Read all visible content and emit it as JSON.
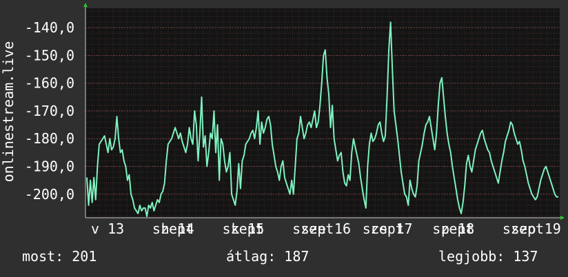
{
  "chart_data": {
    "type": "line",
    "ylabel": "onlinestream.live",
    "ylim": [
      -208.5,
      -133
    ],
    "y_ticks": [
      -200.0,
      -190.0,
      -180.0,
      -170.0,
      -160.0,
      -150.0,
      -140.0
    ],
    "y_tick_labels": [
      "-200,0",
      "-190,0",
      "-180,0",
      "-170,0",
      "-160,0",
      "-150,0",
      "-140,0"
    ],
    "x_tick_labels": [
      "v 13",
      "szept",
      "h 14",
      "szept",
      "k 15",
      "szept",
      "sze 16",
      "szept",
      "cs 17",
      "szept",
      "p 18",
      "szept",
      "szo 19",
      "szept"
    ],
    "x_tick_positions": [
      0.0,
      0.14,
      0.16,
      0.3,
      0.32,
      0.46,
      0.48,
      0.62,
      0.64,
      0.78,
      0.8,
      0.94,
      0.96,
      1.1
    ],
    "grid": true,
    "line_color": "#7ef2bf",
    "background_color": "#141414",
    "grid_color": "#5a3a3a",
    "series": [
      {
        "values": [
          -194,
          -204,
          -195,
          -203,
          -194,
          -202,
          -190,
          -182,
          -181,
          -180,
          -179,
          -182,
          -185,
          -180,
          -184,
          -183,
          -180,
          -172,
          -180,
          -185,
          -184,
          -188,
          -190,
          -195,
          -193,
          -200,
          -202,
          -205,
          -206,
          -207,
          -204,
          -206,
          -205,
          -205,
          -208,
          -204,
          -205,
          -203,
          -206,
          -204,
          -202,
          -203,
          -200,
          -199,
          -196,
          -188,
          -182,
          -181,
          -180,
          -178,
          -176,
          -178,
          -180,
          -178,
          -181,
          -183,
          -185,
          -182,
          -176,
          -180,
          -182,
          -170,
          -175,
          -188,
          -178,
          -165,
          -183,
          -179,
          -190,
          -185,
          -178,
          -180,
          -170,
          -185,
          -175,
          -195,
          -180,
          -182,
          -188,
          -192,
          -190,
          -185,
          -200,
          -202,
          -204,
          -199,
          -189,
          -198,
          -188,
          -186,
          -182,
          -181,
          -180,
          -178,
          -177,
          -180,
          -176,
          -170,
          -182,
          -174,
          -178,
          -176,
          -173,
          -172,
          -175,
          -182,
          -186,
          -190,
          -192,
          -195,
          -190,
          -188,
          -194,
          -196,
          -198,
          -200,
          -195,
          -200,
          -190,
          -180,
          -178,
          -172,
          -176,
          -180,
          -178,
          -175,
          -174,
          -176,
          -173,
          -170,
          -176,
          -174,
          -168,
          -160,
          -150,
          -148,
          -158,
          -164,
          -176,
          -168,
          -180,
          -184,
          -188,
          -186,
          -185,
          -192,
          -196,
          -197,
          -193,
          -195,
          -185,
          -180,
          -183,
          -186,
          -189,
          -194,
          -198,
          -202,
          -205,
          -190,
          -182,
          -178,
          -181,
          -180,
          -178,
          -175,
          -174,
          -178,
          -181,
          -179,
          -165,
          -148,
          -138,
          -155,
          -170,
          -175,
          -180,
          -186,
          -192,
          -196,
          -200,
          -201,
          -204,
          -195,
          -198,
          -200,
          -201,
          -197,
          -188,
          -185,
          -182,
          -178,
          -175,
          -174,
          -172,
          -176,
          -180,
          -184,
          -178,
          -168,
          -160,
          -158,
          -165,
          -172,
          -178,
          -182,
          -185,
          -190,
          -194,
          -198,
          -202,
          -205,
          -207,
          -203,
          -197,
          -189,
          -186,
          -190,
          -192,
          -188,
          -184,
          -182,
          -180,
          -178,
          -177,
          -180,
          -182,
          -184,
          -185,
          -188,
          -190,
          -192,
          -194,
          -196,
          -192,
          -188,
          -185,
          -181,
          -179,
          -177,
          -174,
          -175,
          -178,
          -180,
          -182,
          -181,
          -184,
          -188,
          -190,
          -193,
          -196,
          -198,
          -200,
          -201,
          -202,
          -201,
          -198,
          -195,
          -193,
          -191,
          -190,
          -192,
          -194,
          -196,
          -198,
          -200,
          -201,
          -201
        ]
      }
    ]
  },
  "footer": {
    "now": "most: 201",
    "avg": "átlag: 187",
    "best": "legjobb: 137"
  }
}
